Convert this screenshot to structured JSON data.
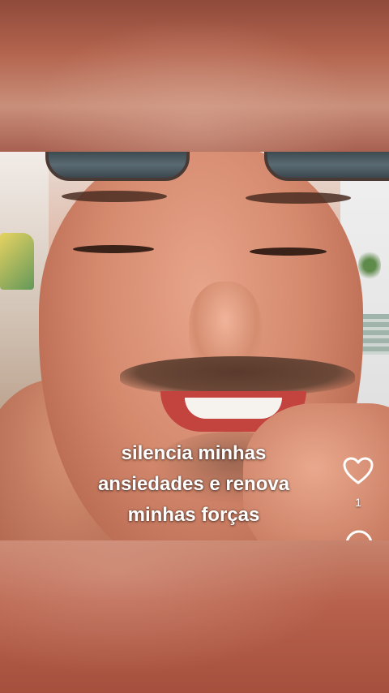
{
  "caption": {
    "lines": [
      "silencia minhas",
      "ansiedades e renova",
      "minhas forças"
    ]
  },
  "actions": {
    "like_icon": "heart-outline-icon",
    "like_count": "1",
    "comment_icon": "comment-bubble-icon"
  },
  "colors": {
    "caption_text": "#ffffff",
    "blur_backdrop": "#b35a44"
  }
}
